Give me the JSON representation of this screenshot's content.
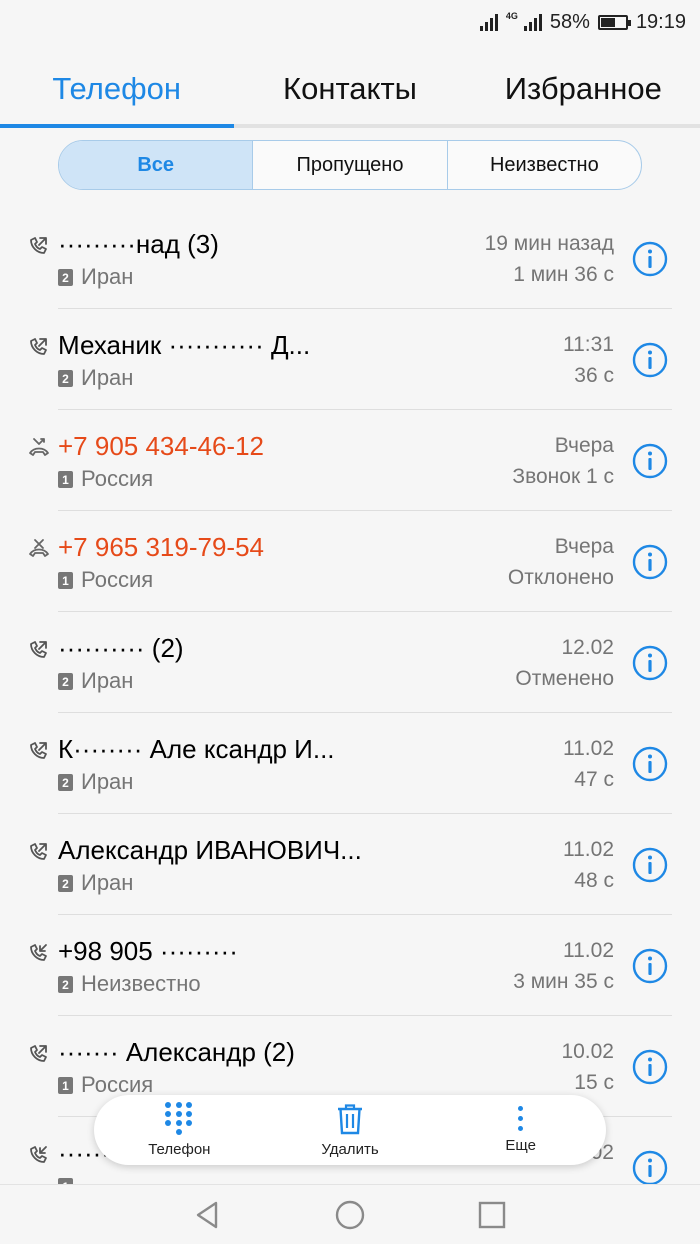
{
  "status_bar": {
    "network_label": "4G",
    "battery_percent_text": "58%",
    "battery_level": 0.58,
    "time": "19:19"
  },
  "tabs": [
    {
      "label": "Телефон",
      "active": true
    },
    {
      "label": "Контакты",
      "active": false
    },
    {
      "label": "Избранное",
      "active": false
    }
  ],
  "filters": [
    {
      "label": "Все",
      "active": true
    },
    {
      "label": "Пропущено",
      "active": false
    },
    {
      "label": "Неизвестно",
      "active": false
    }
  ],
  "calls": [
    {
      "name": "·········нaд (3)",
      "sim": "2",
      "location": "Иран",
      "time": "19 мин назад",
      "detail": "1 мин 36 с",
      "type": "outgoing",
      "missed": false
    },
    {
      "name": "Механик ··········· Д...",
      "sim": "2",
      "location": "Иран",
      "time": "11:31",
      "detail": "36 с",
      "type": "outgoing",
      "missed": false
    },
    {
      "name": "+7 905 434-46-12",
      "sim": "1",
      "location": "Россия",
      "time": "Вчера",
      "detail": "Звонок 1 с",
      "type": "missed",
      "missed": true
    },
    {
      "name": "+7 965 319-79-54",
      "sim": "1",
      "location": "Россия",
      "time": "Вчера",
      "detail": "Отклонено",
      "type": "rejected",
      "missed": true
    },
    {
      "name": "·········· (2)",
      "sim": "2",
      "location": "Иран",
      "time": "12.02",
      "detail": "Отменено",
      "type": "outgoing",
      "missed": false
    },
    {
      "name": "К········ Але ксандр И...",
      "sim": "2",
      "location": "Иран",
      "time": "11.02",
      "detail": "47 с",
      "type": "outgoing",
      "missed": false
    },
    {
      "name": "Александр ИВАНОВИЧ...",
      "sim": "2",
      "location": "Иран",
      "time": "11.02",
      "detail": "48 с",
      "type": "outgoing",
      "missed": false
    },
    {
      "name": "+98 905 ·········",
      "sim": "2",
      "location": "Неизвестно",
      "time": "11.02",
      "detail": "3 мин 35 с",
      "type": "incoming",
      "missed": false
    },
    {
      "name": "······· Александр (2)",
      "sim": "1",
      "location": "Россия",
      "time": "10.02",
      "detail": "15 с",
      "type": "outgoing",
      "missed": false
    },
    {
      "name": "········",
      "sim": "1",
      "location": "",
      "time": "10.02",
      "detail": "",
      "type": "incoming",
      "missed": false
    }
  ],
  "actions": [
    {
      "label": "Телефон",
      "icon": "dialpad-icon"
    },
    {
      "label": "Удалить",
      "icon": "trash-icon"
    },
    {
      "label": "Еще",
      "icon": "more-vertical-icon"
    }
  ],
  "colors": {
    "accent": "#1e88e5",
    "missed": "#e64a19",
    "secondary_text": "#757575"
  }
}
